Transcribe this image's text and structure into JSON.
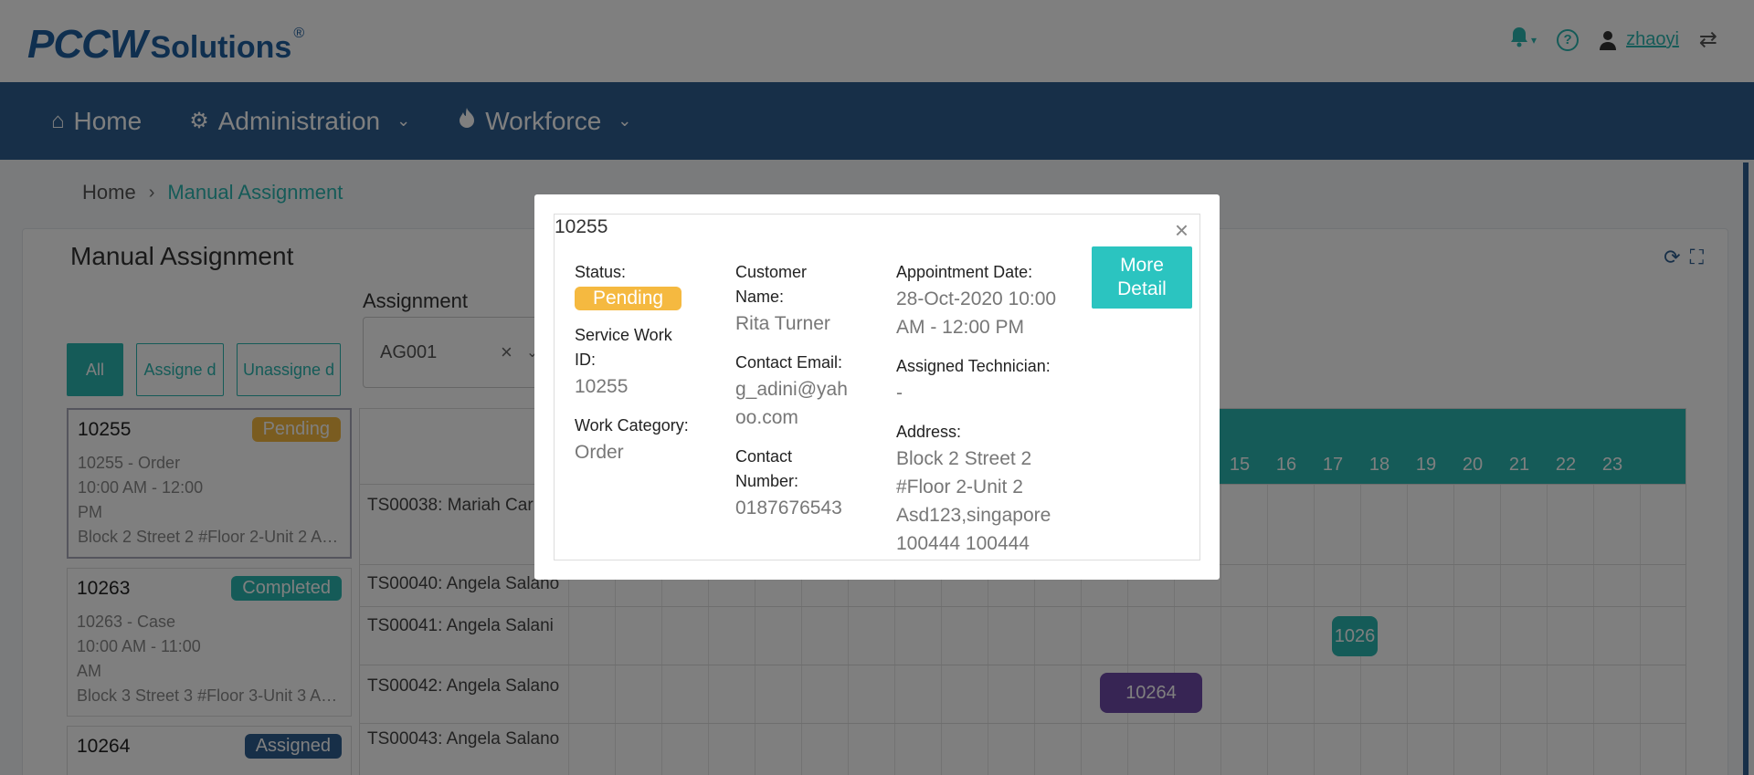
{
  "header": {
    "logo_main": "PCCW",
    "logo_sub": "Solutions",
    "logo_reg": "®",
    "username": "zhaoyi"
  },
  "nav": {
    "home": "Home",
    "administration": "Administration",
    "workforce": "Workforce"
  },
  "breadcrumb": {
    "home": "Home",
    "current": "Manual Assignment"
  },
  "page": {
    "title": "Manual Assignment",
    "assignment_label": "Assignment",
    "assignment_value": "AG001",
    "filters": [
      "All",
      "Assigne d",
      "Unassigne d"
    ]
  },
  "jobs": [
    {
      "id": "10255",
      "status": "Pending",
      "line1": "10255 - Order",
      "line2": "10:00 AM - 12:00",
      "line3": "PM",
      "line4": "Block 2 Street 2 #Floor 2-Unit 2 As..."
    },
    {
      "id": "10263",
      "status": "Completed",
      "line1": "10263 - Case",
      "line2": "10:00 AM - 11:00",
      "line3": "AM",
      "line4": "Block 3 Street 3 #Floor 3-Unit 3 As..."
    },
    {
      "id": "10264",
      "status": "Assigned"
    }
  ],
  "schedule": {
    "hours": [
      "15",
      "16",
      "17",
      "18",
      "19",
      "20",
      "21",
      "22",
      "23"
    ],
    "technicians": [
      {
        "code": "TS00038:",
        "name": "Mariah Car"
      },
      {
        "code": "TS00040:",
        "name": "Angela Salano"
      },
      {
        "code": "TS00041:",
        "name": "Angela Salani"
      },
      {
        "code": "TS00042:",
        "name": "Angela Salano"
      },
      {
        "code": "TS00043:",
        "name": "Angela Salano"
      }
    ],
    "events": [
      {
        "label": "1026"
      },
      {
        "label": "10264"
      }
    ]
  },
  "colors": {
    "brand_blue": "#2f5f90",
    "teal": "#2bb7b0",
    "pending": "#f5b940",
    "purple": "#6f4aa8"
  },
  "modal": {
    "title": "10255",
    "close": "×",
    "status_label": "Status:",
    "status_value": "Pending",
    "service_label_1": "Service Work",
    "service_label_2": "ID:",
    "service_value": "10255",
    "category_label": "Work Category:",
    "category_value": "Order",
    "customer_label_1": "Customer",
    "customer_label_2": "Name:",
    "customer_value": "Rita Turner",
    "email_label": "Contact Email:",
    "email_value_1": "g_adini@yah",
    "email_value_2": "oo.com",
    "number_label_1": "Contact",
    "number_label_2": "Number:",
    "number_value": "0187676543",
    "appt_label": "Appointment Date:",
    "appt_value_1": "28-Oct-2020 10:00",
    "appt_value_2": "AM - 12:00 PM",
    "tech_label": "Assigned Technician:",
    "tech_value": "-",
    "address_label": "Address:",
    "address_1": "Block 2 Street 2",
    "address_2": "#Floor 2-Unit 2",
    "address_3": "Asd123,singapore",
    "address_4": "100444 100444",
    "more_button_1": "More",
    "more_button_2": "Detail"
  }
}
